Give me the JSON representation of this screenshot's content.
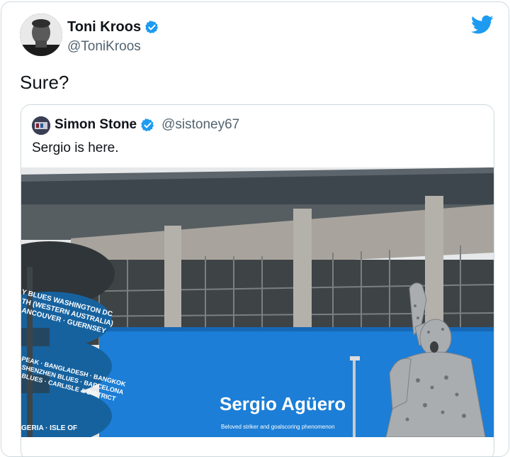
{
  "tweet": {
    "display_name": "Toni Kroos",
    "handle": "@ToniKroos",
    "text": "Sure?",
    "verified": true,
    "logo_icon": "twitter-bird-icon",
    "accent_color": "#1d9bf0"
  },
  "quoted_tweet": {
    "display_name": "Simon Stone",
    "handle": "@sistoney67",
    "text": "Sergio is here.",
    "verified": true,
    "media": {
      "banner_title": "Sergio Agüero",
      "banner_subtitle": "Beloved striker and goalscoring phenomenon",
      "ring_text_1": "Y BLUES WASHINGTON DC",
      "ring_text_2": "TH (WESTERN AUSTRALIA)",
      "ring_text_3": "ANCOUVER · GUERNSEY",
      "ring_text_4": "PEAK · BANGLADESH · BANGKOK",
      "ring_text_5": "SHENZHEN BLUES · BARCELONA",
      "ring_text_6": "BLUES · CARLISLE & DISTRICT",
      "ring_text_7": "GERIA · ISLE OF"
    }
  }
}
